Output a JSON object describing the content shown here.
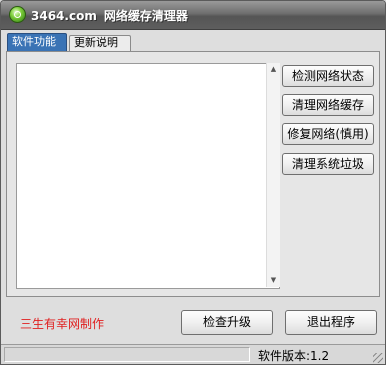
{
  "window": {
    "site": "3464.com",
    "title": "网络缓存清理器"
  },
  "tabs": [
    {
      "label": "软件功能",
      "active": true
    },
    {
      "label": "更新说明",
      "active": false
    }
  ],
  "actions": {
    "check_network": "检测网络状态",
    "clear_cache": "清理网络缓存",
    "repair_network": "修复网络(慎用)",
    "clean_junk": "清理系统垃圾"
  },
  "footer": {
    "credit": "三生有幸网制作",
    "credit_color": "#e02020",
    "upgrade_button": "检查升级",
    "exit_button": "退出程序"
  },
  "status": {
    "version": "软件版本:1.2"
  },
  "log_output": ""
}
